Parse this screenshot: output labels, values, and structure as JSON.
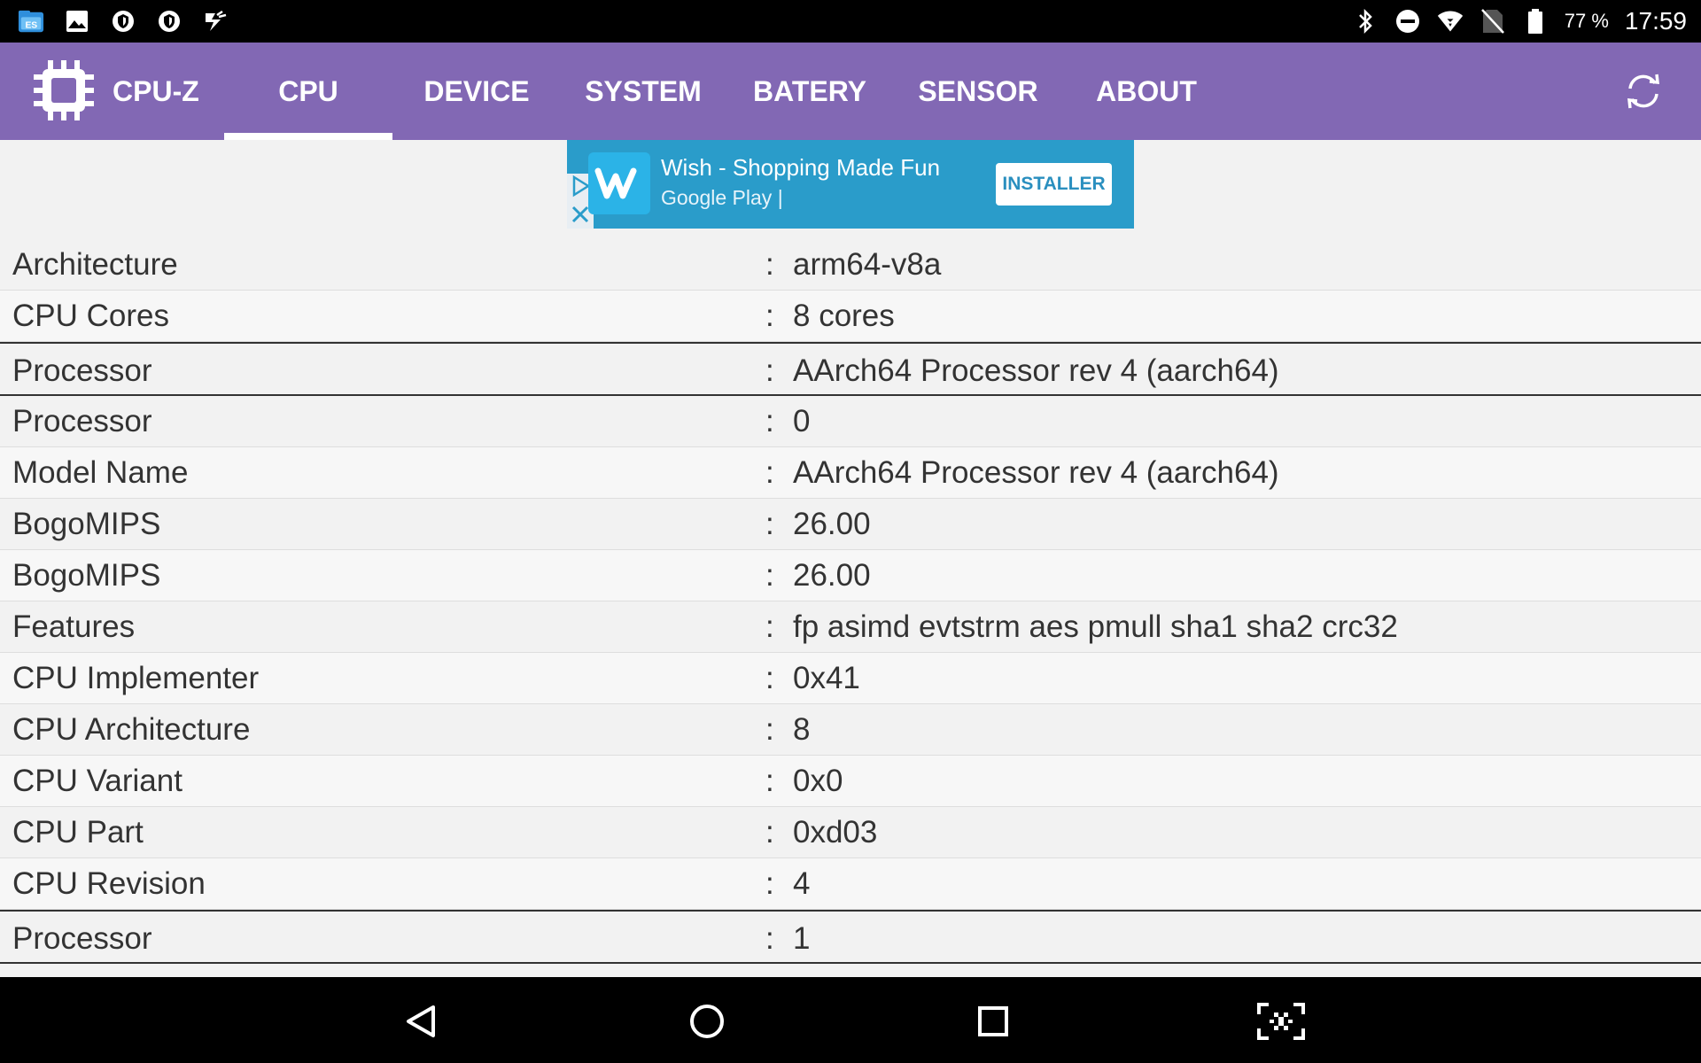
{
  "status_bar": {
    "battery_percent": "77 %",
    "time": "17:59",
    "left_icons": [
      "file-manager-icon",
      "image-icon",
      "shield-icon",
      "shield-icon",
      "tasker-icon"
    ],
    "right_icons": [
      "bluetooth-icon",
      "do-not-disturb-icon",
      "wifi-icon",
      "no-sim-icon",
      "battery-icon"
    ]
  },
  "app_bar": {
    "title": "CPU-Z",
    "tabs": [
      {
        "label": "CPU",
        "active": true
      },
      {
        "label": "DEVICE",
        "active": false
      },
      {
        "label": "SYSTEM",
        "active": false
      },
      {
        "label": "BATERY",
        "active": false
      },
      {
        "label": "SENSOR",
        "active": false
      },
      {
        "label": "ABOUT",
        "active": false
      }
    ],
    "accent_color": "#8268b4"
  },
  "ad": {
    "title": "Wish - Shopping Made Fun",
    "store": "Google Play",
    "separator": "|",
    "install_label": "INSTALLER"
  },
  "rows": [
    {
      "label": "Architecture",
      "value": "arm64-v8a"
    },
    {
      "label": "CPU Cores",
      "value": "8 cores"
    },
    {
      "label": "Processor",
      "value": "AArch64 Processor rev 4 (aarch64)"
    },
    {
      "label": "Processor",
      "value": "0"
    },
    {
      "label": "Model Name",
      "value": "AArch64 Processor rev 4 (aarch64)"
    },
    {
      "label": "BogoMIPS",
      "value": "26.00"
    },
    {
      "label": "BogoMIPS",
      "value": "26.00"
    },
    {
      "label": "Features",
      "value": "fp asimd evtstrm aes pmull sha1 sha2 crc32"
    },
    {
      "label": "CPU Implementer",
      "value": "0x41"
    },
    {
      "label": "CPU Architecture",
      "value": "8"
    },
    {
      "label": "CPU Variant",
      "value": "0x0"
    },
    {
      "label": "CPU Part",
      "value": "0xd03"
    },
    {
      "label": "CPU Revision",
      "value": "4"
    },
    {
      "label": "Processor",
      "value": "1"
    }
  ],
  "separator": ":"
}
